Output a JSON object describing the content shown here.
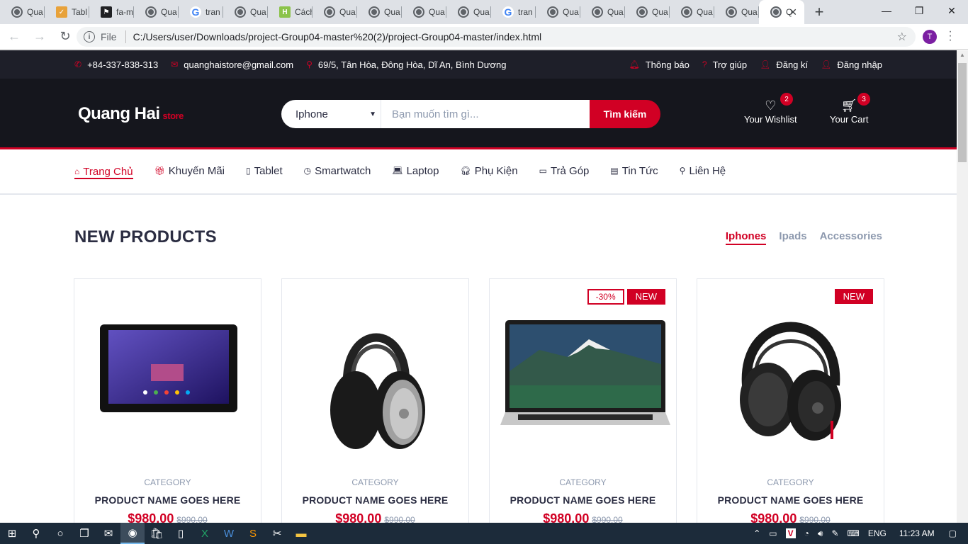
{
  "browser": {
    "tabs": [
      {
        "icon": "globe-icon",
        "title": "Qua"
      },
      {
        "icon": "fa-icon",
        "title": "Tabl"
      },
      {
        "icon": "flag-icon",
        "title": "fa-m"
      },
      {
        "icon": "globe-icon",
        "title": "Qua"
      },
      {
        "icon": "google-icon",
        "title": "tran"
      },
      {
        "icon": "globe-icon",
        "title": "Qua"
      },
      {
        "icon": "h-icon",
        "title": "Cách"
      },
      {
        "icon": "globe-icon",
        "title": "Qua"
      },
      {
        "icon": "globe-icon",
        "title": "Qua"
      },
      {
        "icon": "globe-icon",
        "title": "Qua"
      },
      {
        "icon": "globe-icon",
        "title": "Qua"
      },
      {
        "icon": "google-icon",
        "title": "tran"
      },
      {
        "icon": "globe-icon",
        "title": "Qua"
      },
      {
        "icon": "globe-icon",
        "title": "Qua"
      },
      {
        "icon": "globe-icon",
        "title": "Qua"
      },
      {
        "icon": "globe-icon",
        "title": "Qua"
      },
      {
        "icon": "globe-icon",
        "title": "Qua"
      }
    ],
    "active_tab_title": "Q",
    "address_prefix": "File",
    "url": "C:/Users/user/Downloads/project-Group04-master%20(2)/project-Group04-master/index.html",
    "profile_initial": "T"
  },
  "top_header": {
    "phone": "+84-337-838-313",
    "email": "quanghaistore@gmail.com",
    "address": "69/5, Tân Hòa, Đông Hòa, Dĩ An, Bình Dương",
    "links": [
      "Thông báo",
      "Trợ giúp",
      "Đăng kí",
      "Đăng nhập"
    ]
  },
  "header": {
    "logo_main": "Quang Hai",
    "logo_sub": "store",
    "search_category": "Iphone",
    "search_placeholder": "Bạn muốn tìm gì...",
    "search_button": "Tìm kiếm",
    "wishlist_label": "Your Wishlist",
    "wishlist_count": "2",
    "cart_label": "Your Cart",
    "cart_count": "3"
  },
  "nav": [
    "Trang Chủ",
    "Khuyến Mãi",
    "Tablet",
    "Smartwatch",
    "Laptop",
    "Phụ Kiện",
    "Trả Góp",
    "Tin Tức",
    "Liên Hệ"
  ],
  "section": {
    "title": "NEW PRODUCTS",
    "tabs": [
      "Iphones",
      "Ipads",
      "Accessories"
    ]
  },
  "products": [
    {
      "image": "tablet",
      "sale": "",
      "new": "",
      "category": "CATEGORY",
      "name": "PRODUCT NAME GOES HERE",
      "price": "$980.00",
      "old_price": "$990.00"
    },
    {
      "image": "headphones-silver",
      "sale": "",
      "new": "",
      "category": "CATEGORY",
      "name": "PRODUCT NAME GOES HERE",
      "price": "$980.00",
      "old_price": "$990.00"
    },
    {
      "image": "laptop",
      "sale": "-30%",
      "new": "NEW",
      "category": "CATEGORY",
      "name": "PRODUCT NAME GOES HERE",
      "price": "$980.00",
      "old_price": "$990.00"
    },
    {
      "image": "headphones-black",
      "sale": "",
      "new": "NEW",
      "category": "CATEGORY",
      "name": "PRODUCT NAME GOES HERE",
      "price": "$980.00",
      "old_price": "$990.00"
    }
  ],
  "taskbar": {
    "language": "ENG",
    "time": "11:23 AM"
  },
  "colors": {
    "accent": "#d10024",
    "dark": "#15161d",
    "topbar": "#1e1f29"
  }
}
